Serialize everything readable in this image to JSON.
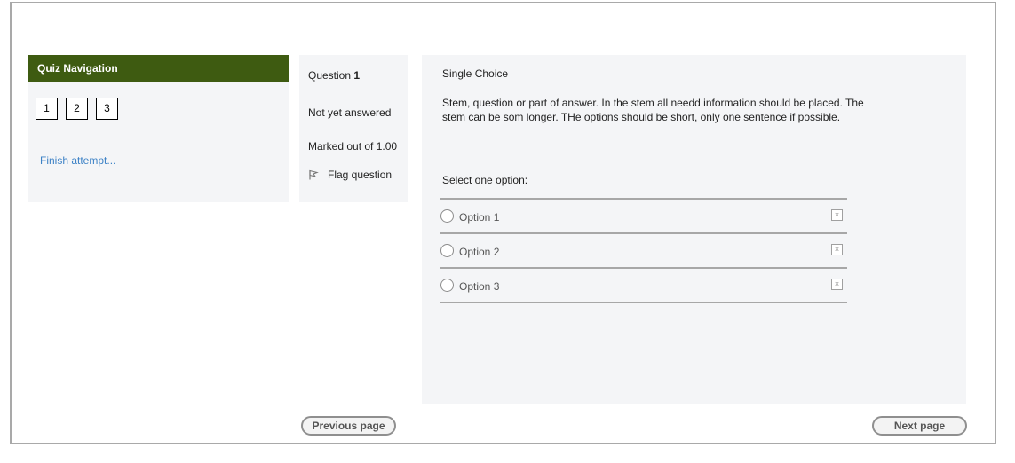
{
  "nav": {
    "header": "Quiz Navigation",
    "buttons": [
      "1",
      "2",
      "3"
    ],
    "finish_label": "Finish attempt..."
  },
  "info": {
    "question_prefix": "Question",
    "question_number": "1",
    "state": "Not yet answered",
    "marked": "Marked out of 1.00",
    "flag_label": "Flag question"
  },
  "question": {
    "type": "Single Choice",
    "stem": "Stem, question or part of answer. In the stem all needd information should be placed. The stem can be som longer. THe options should be short, only one sentence if possible.",
    "prompt": "Select one option:",
    "options": [
      "Option 1",
      "Option 2",
      "Option 3"
    ],
    "clear_icon": "×"
  },
  "pager": {
    "prev_label": "Previous page",
    "next_label": "Next page"
  },
  "colors": {
    "nav_header_bg": "#3e5b11",
    "link": "#3d82c6",
    "panel_bg": "#f4f5f7"
  },
  "icons": {
    "flag": "flag-icon",
    "clear": "clear-choice-icon",
    "radio": "radio-icon"
  }
}
